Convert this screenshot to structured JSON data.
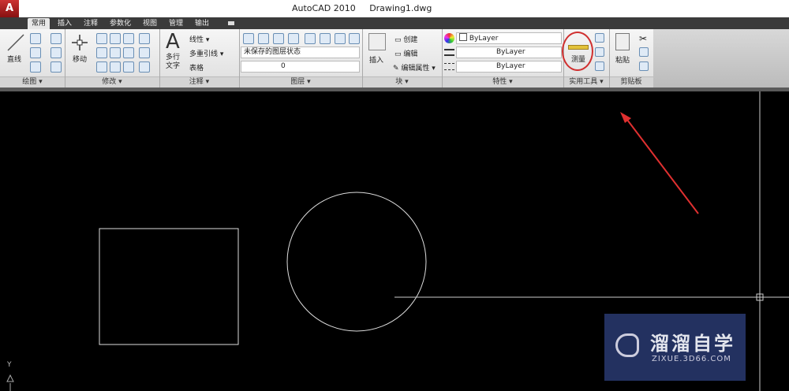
{
  "titlebar": {
    "app_menu": "A",
    "title": "AutoCAD 2010     Drawing1.dwg"
  },
  "tabs": [
    "常用",
    "插入",
    "注释",
    "参数化",
    "视图",
    "管理",
    "输出"
  ],
  "active_tab": "常用",
  "draw_panel": {
    "line": "直线",
    "label": "绘图 ▾"
  },
  "modify_panel": {
    "move": "移动",
    "label": "修改 ▾"
  },
  "annotation_panel": {
    "mtext_big": "A",
    "mtext": "多行\n文字",
    "linear": "线性 ▾",
    "mleader": "多重引线 ▾",
    "table": "表格",
    "label": "注释 ▾"
  },
  "layers_panel": {
    "layer_state": "未保存的图层状态",
    "layer": "0",
    "label": "图层 ▾"
  },
  "block_panel": {
    "insert": "插入",
    "create": "创建",
    "edit": "编辑",
    "edit_attr": "编辑属性 ▾",
    "label": "块 ▾"
  },
  "properties_panel": {
    "color": "ByLayer",
    "linetype": "ByLayer",
    "lineweight": "ByLayer",
    "label": "特性 ▾"
  },
  "utilities_panel": {
    "measure": "测量",
    "label": "实用工具 ▾",
    "highlight_color": "#d03030"
  },
  "clipboard_panel": {
    "paste": "粘贴",
    "label": "剪贴板"
  },
  "canvas": {
    "background": "#000000",
    "ucs_y": "Y",
    "arrow_color": "#e03030"
  },
  "watermark": {
    "brand": "溜溜自学",
    "url": "ZIXUE.3D66.COM",
    "background": "#233160"
  }
}
